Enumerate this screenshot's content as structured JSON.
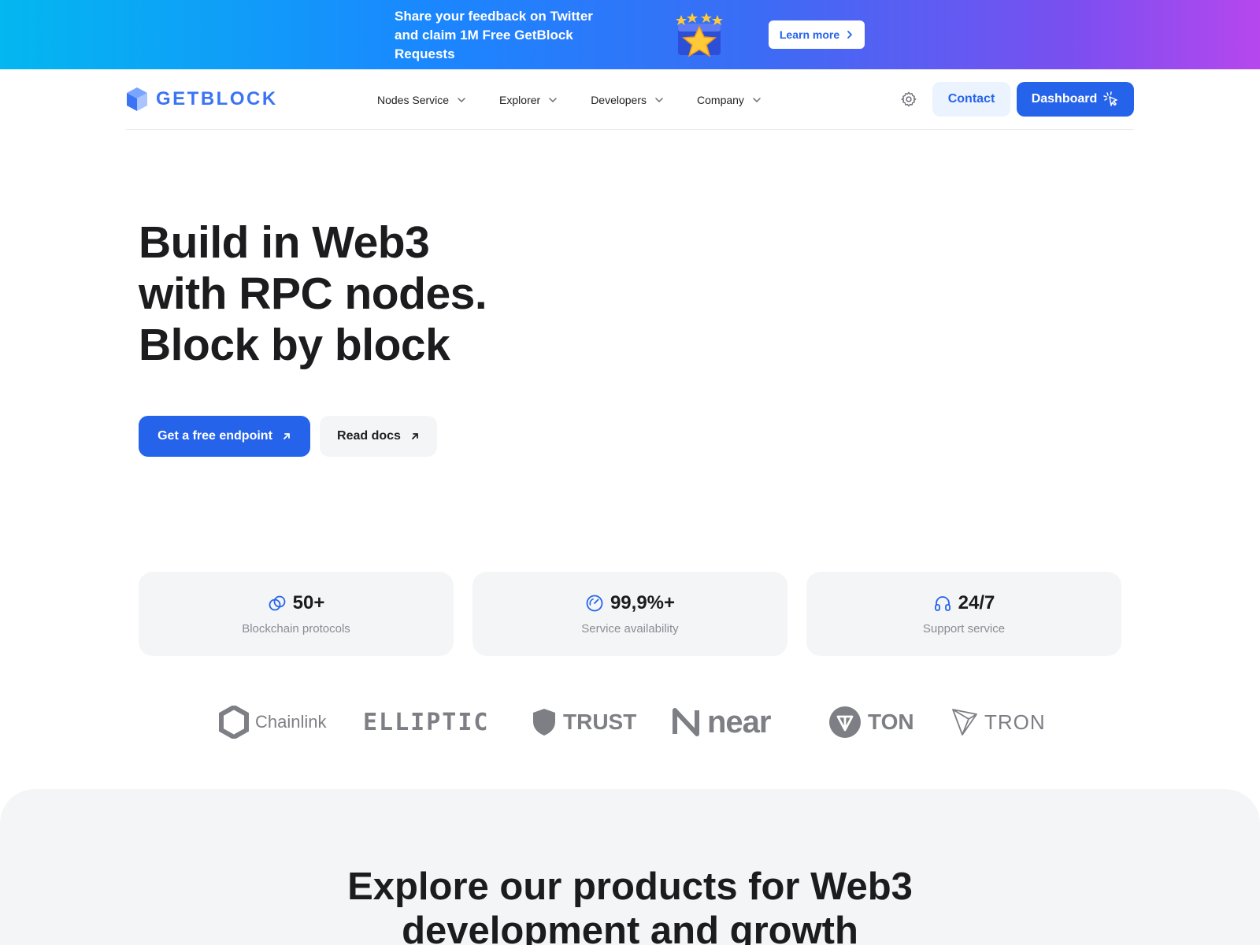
{
  "promo": {
    "lines": [
      "Share your feedback on Twitter",
      "and claim 1M Free GetBlock",
      "Requests"
    ],
    "button_label": "Learn more"
  },
  "header": {
    "logo_text": "GETBLOCK",
    "nav": [
      {
        "label": "Nodes Service"
      },
      {
        "label": "Explorer"
      },
      {
        "label": "Developers"
      },
      {
        "label": "Company"
      }
    ],
    "contact_label": "Contact",
    "dashboard_label": "Dashboard"
  },
  "hero": {
    "title_lines": [
      "Build in Web3",
      "with RPC nodes.",
      "Block by block"
    ],
    "primary_cta": "Get a free endpoint",
    "secondary_cta": "Read docs"
  },
  "stats": [
    {
      "value": "50+",
      "label": "Blockchain protocols",
      "icon": "link-icon"
    },
    {
      "value": "99,9%+",
      "label": "Service availability",
      "icon": "speedometer-icon"
    },
    {
      "value": "24/7",
      "label": "Support service",
      "icon": "headphones-icon"
    }
  ],
  "partners": [
    {
      "name": "Chainlink"
    },
    {
      "name": "ELLIPTIC"
    },
    {
      "name": "TRUST"
    },
    {
      "name": "near"
    },
    {
      "name": "TON"
    },
    {
      "name": "TRON"
    }
  ],
  "section": {
    "title_lines": [
      "Explore our products for Web3",
      "development and growth"
    ]
  },
  "colors": {
    "brand_blue": "#2563eb",
    "logo_blue": "#3a74f5",
    "light_bg": "#f4f5f7",
    "muted_text": "#8a8d94"
  }
}
